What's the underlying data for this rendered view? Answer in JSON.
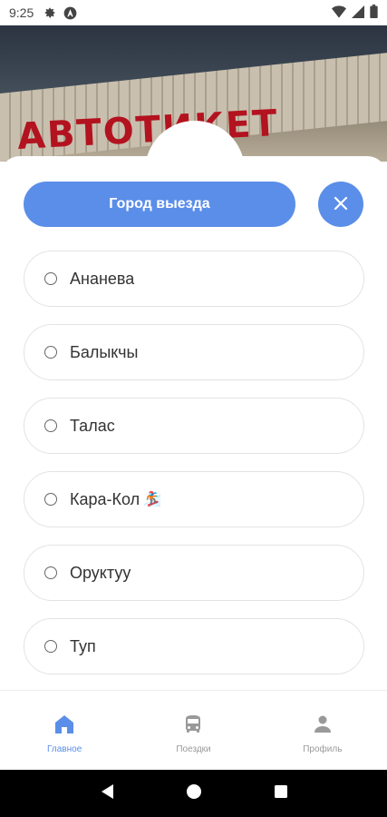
{
  "status_bar": {
    "time": "9:25",
    "left_icons": [
      "gear-icon",
      "a-circle-icon"
    ],
    "right_icons": [
      "wifi-icon",
      "signal-icon",
      "battery-icon"
    ]
  },
  "header": {
    "sign_text": "АВТОТИКЕТ"
  },
  "filter": {
    "city_button_label": "Город выезда",
    "close_icon": "close-icon"
  },
  "cities": [
    {
      "label": "Ананева",
      "emoji": ""
    },
    {
      "label": "Балыкчы",
      "emoji": ""
    },
    {
      "label": "Талас",
      "emoji": ""
    },
    {
      "label": "Кара-Кол",
      "emoji": "🏂"
    },
    {
      "label": "Оруктуу",
      "emoji": ""
    },
    {
      "label": "Туп",
      "emoji": ""
    }
  ],
  "bottom_nav": {
    "items": [
      {
        "label": "Главное",
        "icon": "home-icon",
        "active": true
      },
      {
        "label": "Поездки",
        "icon": "bus-icon",
        "active": false
      },
      {
        "label": "Профиль",
        "icon": "person-icon",
        "active": false
      }
    ]
  },
  "colors": {
    "accent": "#5b8ee8",
    "inactive": "#999999"
  }
}
